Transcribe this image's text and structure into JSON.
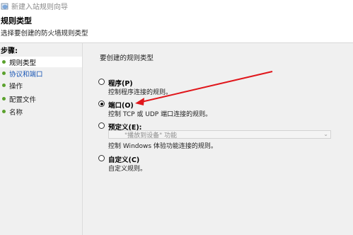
{
  "window": {
    "title": "新建入站规则向导",
    "icon": "shield-rule-icon"
  },
  "header": {
    "title": "规则类型",
    "subtitle": "选择要创建的防火墙规则类型"
  },
  "steps": {
    "title": "步骤:",
    "items": [
      {
        "label": "规则类型",
        "state": "current"
      },
      {
        "label": "协议和端口",
        "state": "next"
      },
      {
        "label": "操作",
        "state": "pending"
      },
      {
        "label": "配置文件",
        "state": "pending"
      },
      {
        "label": "名称",
        "state": "pending"
      }
    ]
  },
  "content": {
    "question": "要创建的规则类型",
    "options": [
      {
        "label": "程序(P)",
        "desc": "控制程序连接的规则。",
        "checked": false
      },
      {
        "label": "端口(O)",
        "desc": "控制 TCP 或 UDP 端口连接的规则。",
        "checked": true
      },
      {
        "label": "预定义(E):",
        "dropdown_value": "\"播放到设备\" 功能",
        "desc": "控制 Windows 体验功能连接的规则。",
        "checked": false
      },
      {
        "label": "自定义(C)",
        "desc": "自定义规则。",
        "checked": false
      }
    ]
  },
  "annotation": {
    "color": "#e0161b"
  },
  "colors": {
    "step_dot": "#5aa12c",
    "link_blue": "#1a56b5",
    "panel_bg": "#f0f0f0"
  }
}
